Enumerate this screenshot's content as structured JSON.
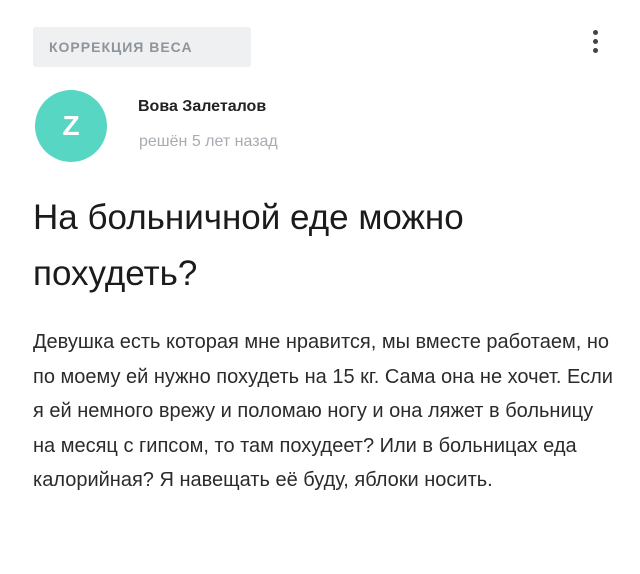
{
  "header": {
    "category": "КОРРЕКЦИЯ ВЕСА",
    "more_icon": "vertical-dots-icon"
  },
  "author": {
    "avatar_letter": "Z",
    "avatar_color": "#57d6c3",
    "name": "Вова Залеталов",
    "time": "решён 5 лет назад"
  },
  "question": {
    "title": "На больничной еде можно похудеть?",
    "body": "Девушка есть которая мне нравится, мы вместе работаем, но по моему ей нужно похудеть на 15 кг. Сама она не хочет. Если я ей немного врежу и поломаю ногу и она ляжет в больницу на месяц с гипсом, то там похудеет? Или в больницах еда калорийная? Я навещать её буду, яблоки носить."
  }
}
